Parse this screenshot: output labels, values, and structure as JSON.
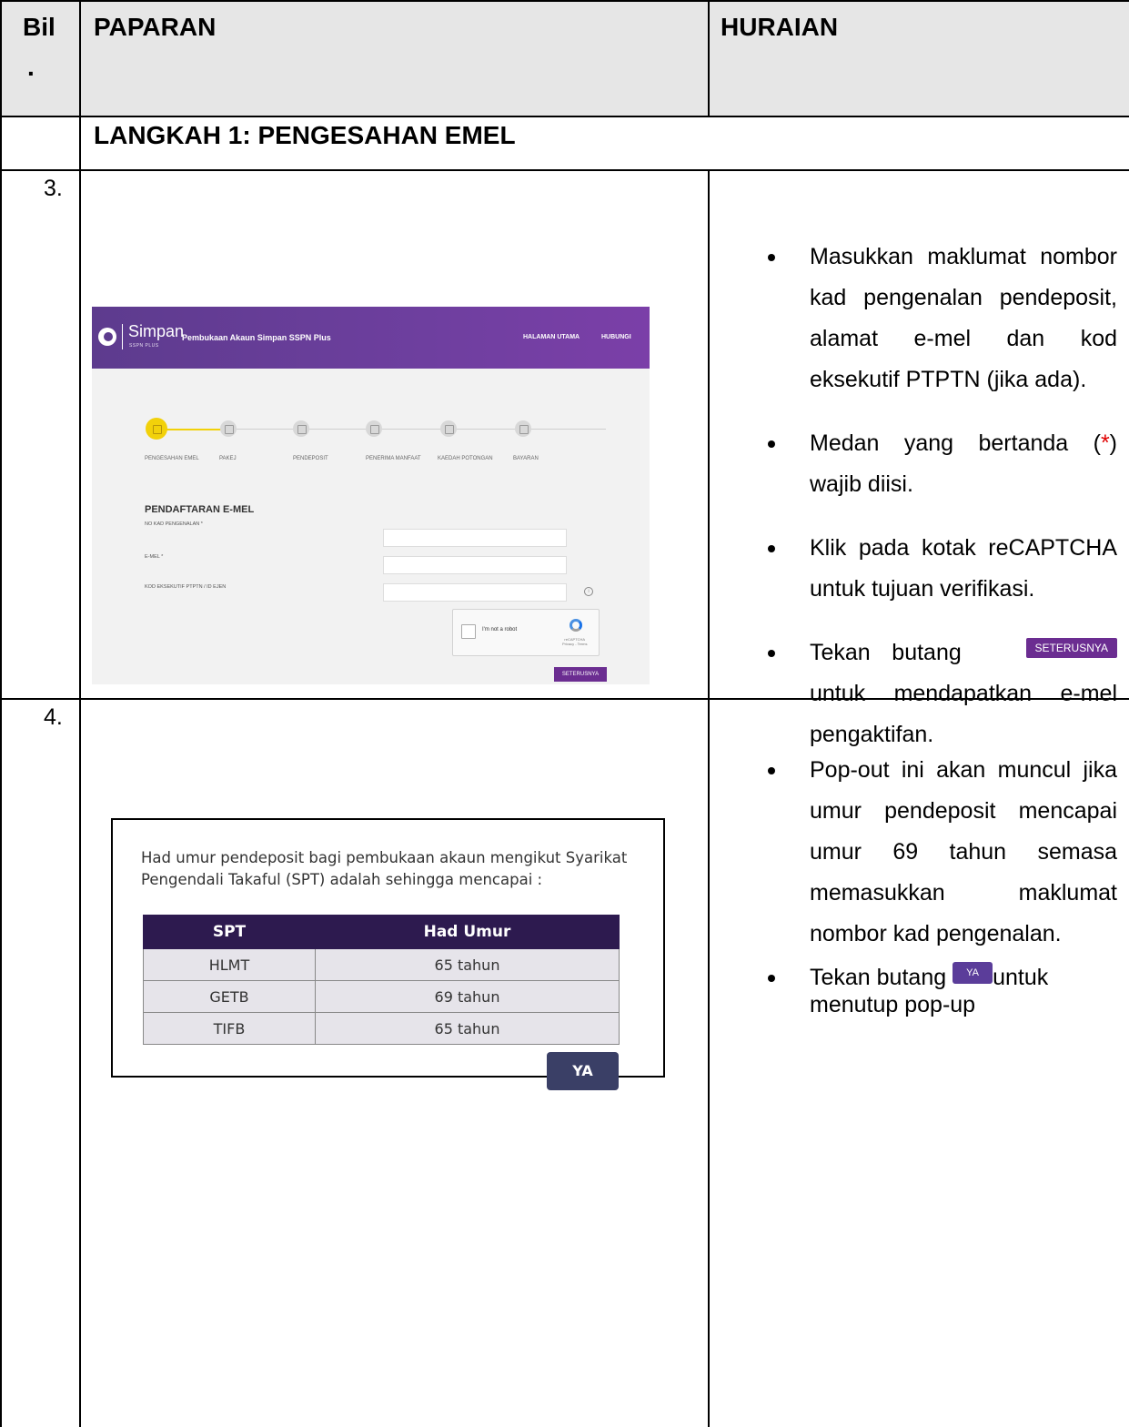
{
  "header": {
    "col_bil": "Bil",
    "col_bil_dot": ".",
    "col_paparan": "PAPARAN",
    "col_huraian": "HURAIAN"
  },
  "section_title": "LANGKAH 1: PENGESAHAN EMEL",
  "step3": {
    "number": "3.",
    "screenshot": {
      "brand": "Simpan",
      "brand_sub": "SSPN PLUS",
      "banner_title": "Pembukaan Akaun Simpan SSPN Plus",
      "nav": [
        "HALAMAN UTAMA",
        "HUBUNGI"
      ],
      "steps": [
        "PENGESAHAN EMEL",
        "PAKEJ",
        "PENDEPOSIT",
        "PENERIMA MANFAAT",
        "KAEDAH POTONGAN",
        "BAYARAN"
      ],
      "form_title": "PENDAFTARAN E-MEL",
      "fields": [
        "NO KAD PENGENALAN *",
        "E-MEL *",
        "KOD EKSEKUTIF PTPTN / ID EJEN"
      ],
      "info_icon_text": "i",
      "captcha_label": "I'm not a robot",
      "captcha_brand": "reCAPTCHA",
      "captcha_links": "Privacy - Terms",
      "next_button": "SETERUSNYA"
    },
    "bullets": {
      "b1": "Masukkan maklumat nombor kad pengenalan pendeposit, alamat e-mel dan kod eksekutif PTPTN (jika ada).",
      "b2_before": "Medan yang bertanda (",
      "b2_star": "*",
      "b2_after": ") wajib diisi.",
      "b3": "Klik pada kotak reCAPTCHA untuk tujuan verifikasi.",
      "b4_before": "Tekan butang",
      "b4_button": "SETERUSNYA",
      "b4_after": "untuk mendapatkan e-mel pengaktifan."
    }
  },
  "step4": {
    "number": "4.",
    "popup": {
      "text": "Had umur pendeposit bagi pembukaan akaun mengikut Syarikat Pengendali Takaful (SPT) adalah sehingga mencapai :",
      "columns": [
        "SPT",
        "Had Umur"
      ],
      "rows": [
        [
          "HLMT",
          "65 tahun"
        ],
        [
          "GETB",
          "69 tahun"
        ],
        [
          "TIFB",
          "65 tahun"
        ]
      ],
      "button": "YA"
    },
    "bullets": {
      "b1": "Pop-out ini akan muncul jika umur pendeposit mencapai umur 69 tahun semasa memasukkan maklumat nombor kad pengenalan.",
      "b2_before": "Tekan butang",
      "b2_button": "YA",
      "b2_after": "untuk menutup pop-up"
    }
  }
}
